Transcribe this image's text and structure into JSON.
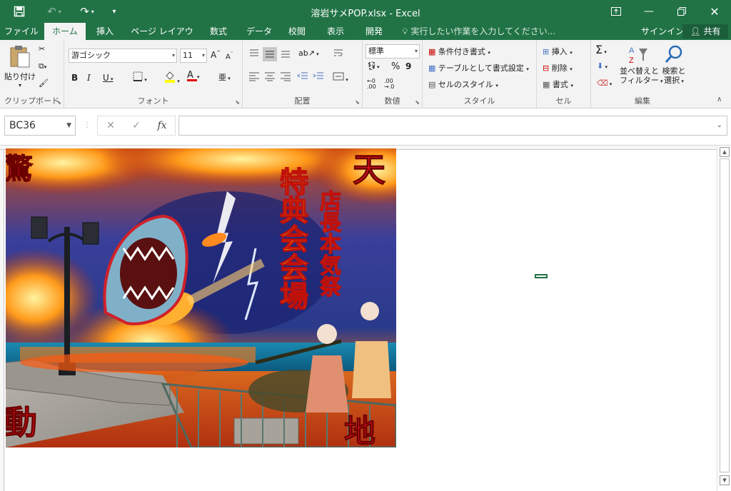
{
  "window": {
    "title": "溶岩サメPOP.xlsx - Excel"
  },
  "tabs": [
    {
      "label": "ファイル"
    },
    {
      "label": "ホーム"
    },
    {
      "label": "挿入"
    },
    {
      "label": "ページ レイアウト"
    },
    {
      "label": "数式"
    },
    {
      "label": "データ"
    },
    {
      "label": "校閲"
    },
    {
      "label": "表示"
    },
    {
      "label": "開発"
    }
  ],
  "tell_me": "実行したい作業を入力してください...",
  "account": {
    "signin": "サインイン",
    "share": "共有"
  },
  "ribbon": {
    "clipboard": {
      "label": "クリップボード",
      "paste": "貼り付け"
    },
    "font": {
      "label": "フォント",
      "font_name": "游ゴシック",
      "font_size": "11",
      "bold": "B",
      "italic": "I",
      "underline": "U",
      "grow": "A",
      "shrink": "A",
      "font_color_letter": "A"
    },
    "alignment": {
      "label": "配置"
    },
    "number": {
      "label": "数値",
      "format": "標準",
      "percent": "%",
      "comma": "9"
    },
    "styles": {
      "label": "スタイル",
      "conditional": "条件付き書式",
      "table": "テーブルとして書式設定",
      "cell_styles": "セルのスタイル"
    },
    "cells": {
      "label": "セル",
      "insert": "挿入",
      "delete": "削除",
      "format": "書式"
    },
    "editing": {
      "label": "編集",
      "sort_line1": "並べ替えと",
      "sort_line2": "フィルター",
      "find_line1": "検索と",
      "find_line2": "選択"
    }
  },
  "formula_bar": {
    "name_box": "BC36",
    "fx": "fx",
    "formula": ""
  },
  "poster": {
    "corner_top_left": "驚",
    "corner_top_right": "天",
    "corner_bottom_left": "動",
    "corner_bottom_right": "地",
    "column_main": "特典会会場",
    "column_sub": "店長本気祭"
  },
  "colors": {
    "excel_green": "#217346",
    "poster_text_red": "#e8141c",
    "poster_text_yellow": "#ffe600"
  }
}
